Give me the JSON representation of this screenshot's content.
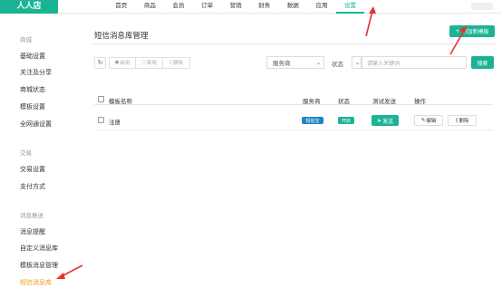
{
  "app": {
    "logo": "人人店"
  },
  "nav": {
    "items": [
      {
        "label": "首页"
      },
      {
        "label": "商品"
      },
      {
        "label": "会员"
      },
      {
        "label": "订单"
      },
      {
        "label": "营销"
      },
      {
        "label": "财务"
      },
      {
        "label": "数据"
      },
      {
        "label": "应用"
      },
      {
        "label": "设置"
      }
    ],
    "active_index": 8
  },
  "sidebar": {
    "groups": [
      {
        "title": "商城",
        "items": [
          "基础设置",
          "关注及分享",
          "商城状态",
          "模板设置",
          "全网通设置"
        ]
      },
      {
        "title": "交易",
        "items": [
          "交易设置",
          "支付方式"
        ]
      },
      {
        "title": "消息推送",
        "items": [
          "消息提醒",
          "自定义消息库",
          "模板消息管理",
          "短信消息库"
        ]
      }
    ],
    "active_item": "短信消息库"
  },
  "main": {
    "title": "短信消息库管理",
    "add_button": "添加新模板",
    "toolbar": {
      "enable": "启用",
      "disable": "禁用",
      "delete": "删除"
    },
    "filters": {
      "provider": "服务商",
      "status_label": "状态",
      "status_value": "",
      "search_placeholder": "请输入关键词",
      "search_button": "搜索"
    },
    "table": {
      "headers": {
        "name": "模板名称",
        "provider": "服务商",
        "status": "状态",
        "test": "测试发送",
        "ops": "操作"
      },
      "rows": [
        {
          "name": "注册",
          "provider": "短信宝",
          "status": "开启",
          "send": "发送",
          "edit": "编辑",
          "delete": "删除"
        }
      ]
    }
  },
  "colors": {
    "accent": "#1ab394",
    "blue": "#1c84c6",
    "active_side": "#f39c12",
    "annotation": "#e8322e"
  },
  "icons": [
    "refresh-icon",
    "plus-icon",
    "send-icon",
    "edit-icon",
    "trash-icon",
    "caret-down-icon"
  ]
}
